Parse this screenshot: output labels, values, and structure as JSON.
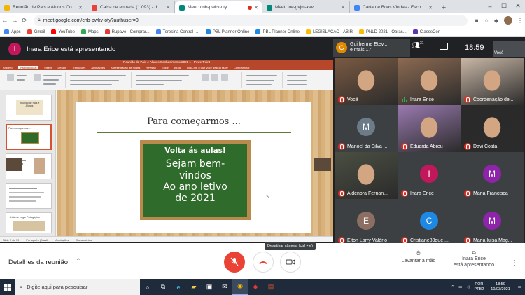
{
  "browser": {
    "tabs": [
      {
        "title": "Reunião de Pais e Alunos Cont...",
        "color": "#f4b400"
      },
      {
        "title": "Caixa de entrada (1.093) - den...",
        "color": "#ea4335"
      },
      {
        "title": "Meet: cnb-pwkv-oty",
        "color": "#00897b",
        "active": true
      },
      {
        "title": "Meet: ioe-gvjm-xev",
        "color": "#00897b"
      },
      {
        "title": "Carta de Boas Vindas - Escola...",
        "color": "#4285f4"
      }
    ],
    "new_tab": "+",
    "url": "meet.google.com/cnb-pwkv-oty?authuser=0",
    "bookmarks": [
      {
        "label": "Apps",
        "color": "#4285f4"
      },
      {
        "label": "Gmail",
        "color": "#ea4335"
      },
      {
        "label": "YouTube",
        "color": "#ff0000"
      },
      {
        "label": "Maps",
        "color": "#34a853"
      },
      {
        "label": "Rupave - Comprar...",
        "color": "#e53935"
      },
      {
        "label": "Teresina Central -...",
        "color": "#4285f4"
      },
      {
        "label": "PBL Planner Online",
        "color": "#1e88e5"
      },
      {
        "label": "PBL Planner Online",
        "color": "#1e88e5"
      },
      {
        "label": "LEGISLAÇÃO - ABIR",
        "color": "#fbbc04"
      },
      {
        "label": "PNLD 2021 - Obras...",
        "color": "#fbbc04"
      },
      {
        "label": "ClasseCon",
        "color": "#5e35b1"
      }
    ]
  },
  "meet": {
    "presenter_initial": "I",
    "presenting_title": "Inara Erice está apresentando",
    "header_tile": {
      "initial": "G",
      "line1": "Guilherme Etev...",
      "line2": "e mais 17"
    },
    "people_count": "31",
    "clock": "18:59",
    "self_label": "Você",
    "participants": [
      {
        "name": "Você",
        "kind": "photo",
        "bg": "#7a5a42",
        "muted": true
      },
      {
        "name": "Inara Erice",
        "kind": "photo",
        "bg": "#8c6a52",
        "muted": false
      },
      {
        "name": "Coordenação de...",
        "kind": "photo",
        "bg": "#c9b7a6",
        "muted": true
      },
      {
        "name": "Manoel da Silva ...",
        "kind": "avatar",
        "initial": "M",
        "color": "#6b7b87",
        "muted": true
      },
      {
        "name": "Eduarda Abreu",
        "kind": "photo",
        "bg": "#9a7ab0",
        "muted": true
      },
      {
        "name": "Davi Costa",
        "kind": "photo",
        "bg": "#2a2a2a",
        "muted": true
      },
      {
        "name": "Aldenora Fernan...",
        "kind": "photo",
        "bg": "#4b4f42",
        "muted": true
      },
      {
        "name": "Inara Erice",
        "kind": "avatar",
        "initial": "I",
        "color": "#c2185b",
        "muted": true
      },
      {
        "name": "Maria Francisca",
        "kind": "avatar",
        "initial": "M",
        "color": "#8e24aa",
        "muted": true
      },
      {
        "name": "Elton Larry Valério",
        "kind": "avatar",
        "initial": "E",
        "color": "#8d6e63",
        "muted": true
      },
      {
        "name": "Cristiane83que ...",
        "kind": "avatar",
        "initial": "C",
        "color": "#1e88e5",
        "muted": true
      },
      {
        "name": "Maria luísa Mag...",
        "kind": "avatar",
        "initial": "M",
        "color": "#8e24aa",
        "muted": true
      }
    ],
    "bottom": {
      "details": "Detalhes da reunião",
      "tooltip": "Desativar câmera (ctrl + e)",
      "raise_hand": "Levantar a mão",
      "presenter_line1": "Inara Erice",
      "presenter_line2": "está apresentando"
    }
  },
  "powerpoint": {
    "title_bar": "Reunião de Pais e Alunos Conhecimento 2021 1  -  PowerPoint",
    "menu": [
      "Arquivo",
      "Página Inicial",
      "Inserir",
      "Design",
      "Transições",
      "Animações",
      "Apresentação de Slides",
      "Revisão",
      "Exibir",
      "Ajuda",
      "Diga-me o que você deseja fazer",
      "Compartilhar"
    ],
    "slide_heading": "Para começarmos ...",
    "board_top": "Volta ás aulas!",
    "board_lines": [
      "Sejam bem-",
      "vindos",
      "Ao ano letivo",
      "de 2021"
    ],
    "status": [
      "Slide 2 de 19",
      "Português (Brasil)",
      "Anotações",
      "Comentários"
    ],
    "thumb_labels": [
      "Reunião de Pais e Alunos",
      "Para começarmos ...",
      "",
      "",
      "Lista de Lugar Pedagógico"
    ]
  },
  "taskbar": {
    "search_placeholder": "Digite aqui para pesquisar",
    "lang_line1": "POR",
    "lang_line2": "PTB2",
    "time": "18:59",
    "date": "10/03/2021"
  }
}
